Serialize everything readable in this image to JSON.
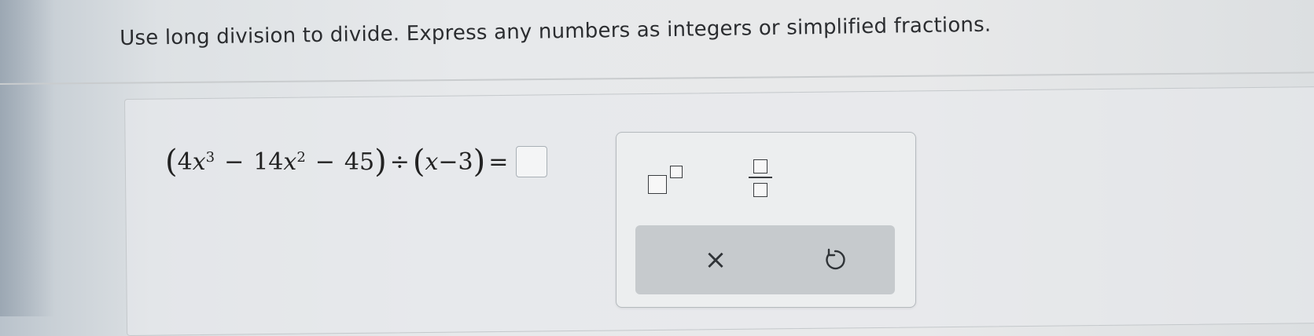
{
  "instruction": "Use long division to divide. Express any numbers as integers or simplified fractions.",
  "equation": {
    "open_paren": "(",
    "coef1": "4",
    "var1": "x",
    "exp1": "3",
    "op1": "−",
    "coef2": "14",
    "var2": "x",
    "exp2": "2",
    "op2": "−",
    "const": "45",
    "close_paren": ")",
    "divide": "÷",
    "open_paren2": "(",
    "var3": "x",
    "op3": "−",
    "divisor_const": "3",
    "close_paren2": ")",
    "equals": "="
  },
  "toolbar": {
    "clear_symbol": "×"
  },
  "icons": {
    "exponent": "exponent-template-icon",
    "fraction": "fraction-template-icon",
    "clear": "clear-icon",
    "undo": "undo-icon"
  },
  "colors": {
    "text": "#2b2d30",
    "panel_border": "#b5babe",
    "action_bar": "#c6cacd"
  }
}
